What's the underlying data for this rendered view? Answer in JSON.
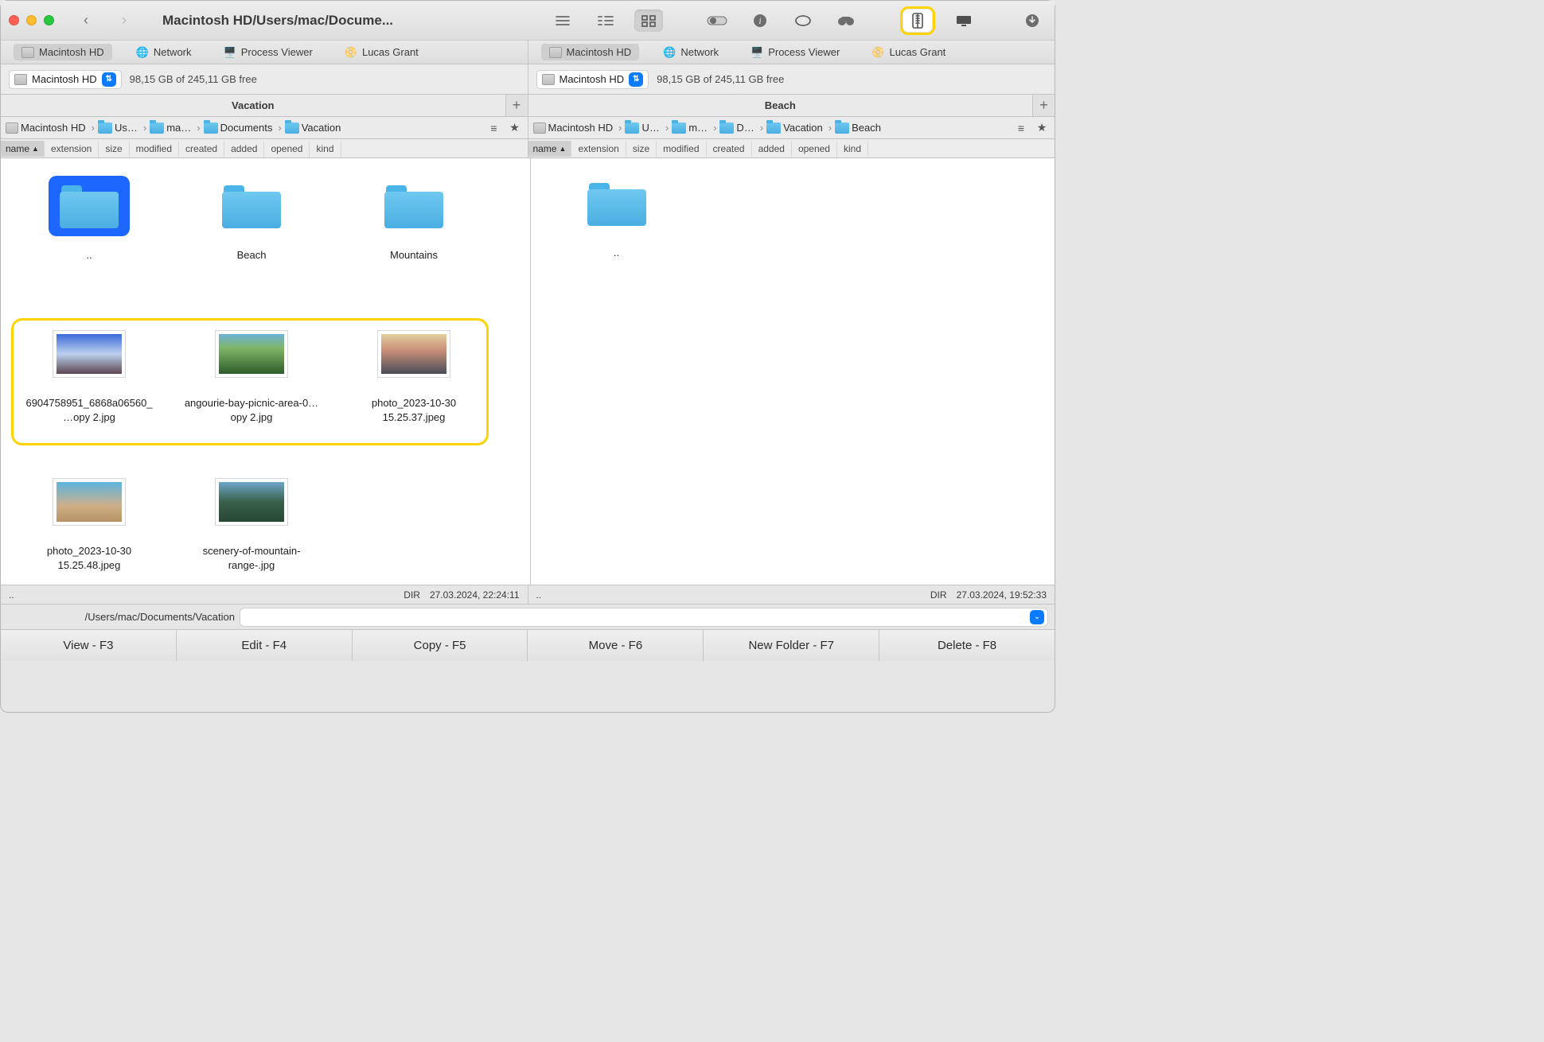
{
  "titlebar": {
    "title": "Macintosh HD/Users/mac/Docume..."
  },
  "toolbar": {
    "back_icon": "‹",
    "forward_icon": "›"
  },
  "shortcuts": [
    {
      "label": "Macintosh HD",
      "icon": "hd",
      "selected": true
    },
    {
      "label": "Network",
      "icon": "globe"
    },
    {
      "label": "Process Viewer",
      "icon": "monitor"
    },
    {
      "label": "Lucas Grant",
      "icon": "drive"
    }
  ],
  "drive": {
    "name": "Macintosh HD",
    "free": "98,15 GB of 245,11 GB free"
  },
  "left": {
    "tab": "Vacation",
    "crumbs": [
      "Macintosh HD",
      "Us…",
      "ma…",
      "Documents",
      "Vacation"
    ],
    "status_dir": "DIR",
    "status_time": "27.03.2024, 22:24:11",
    "status_left": "..",
    "items_folders": [
      {
        "name": "..",
        "updir": true
      },
      {
        "name": "Beach"
      },
      {
        "name": "Mountains"
      }
    ],
    "items_files": [
      {
        "name": "6904758951_6868a06560_…opy 2.jpg",
        "thumb": "sky"
      },
      {
        "name": "angourie-bay-picnic-area-0…opy 2.jpg",
        "thumb": "beach-green"
      },
      {
        "name": "photo_2023-10-30 15.25.37.jpeg",
        "thumb": "sunset"
      },
      {
        "name": "photo_2023-10-30 15.25.48.jpeg",
        "thumb": "ocean"
      },
      {
        "name": "scenery-of-mountain-range-.jpg",
        "thumb": "mtn"
      }
    ]
  },
  "right": {
    "tab": "Beach",
    "crumbs": [
      "Macintosh HD",
      "U…",
      "m…",
      "D…",
      "Vacation",
      "Beach"
    ],
    "status_dir": "DIR",
    "status_time": "27.03.2024, 19:52:33",
    "status_left": "..",
    "items_folders": [
      {
        "name": "..",
        "updir": false
      }
    ]
  },
  "columns": [
    "name",
    "extension",
    "size",
    "modified",
    "created",
    "added",
    "opened",
    "kind"
  ],
  "cmdline": {
    "path": "/Users/mac/Documents/Vacation"
  },
  "fkeys": [
    "View - F3",
    "Edit - F4",
    "Copy - F5",
    "Move - F6",
    "New Folder - F7",
    "Delete - F8"
  ]
}
